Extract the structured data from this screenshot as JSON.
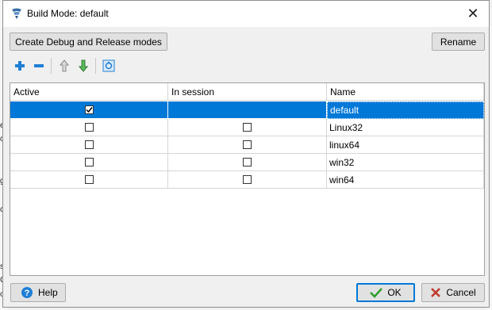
{
  "window": {
    "title": "Build Mode: default"
  },
  "background_left_fragments": [
    "e",
    "o",
    "g",
    "c",
    "s",
    "C",
    "o"
  ],
  "toolbar": {
    "create_modes_label": "Create Debug and Release modes",
    "rename_label": "Rename",
    "icons": [
      "add-icon",
      "remove-icon",
      "move-up-icon",
      "move-down-icon",
      "detect-icon"
    ]
  },
  "table": {
    "headers": [
      "Active",
      "In session",
      "Name"
    ],
    "rows": [
      {
        "name": "default",
        "active": true,
        "in_session": null,
        "selected": true
      },
      {
        "name": "Linux32",
        "active": false,
        "in_session": false,
        "selected": false
      },
      {
        "name": "linux64",
        "active": false,
        "in_session": false,
        "selected": false
      },
      {
        "name": "win32",
        "active": false,
        "in_session": false,
        "selected": false
      },
      {
        "name": "win64",
        "active": false,
        "in_session": false,
        "selected": false
      }
    ]
  },
  "footer": {
    "help_label": "Help",
    "ok_label": "OK",
    "cancel_label": "Cancel"
  },
  "colors": {
    "selection": "#0078d7",
    "add": "#1e7fd6",
    "ok_check": "#2e9e2e",
    "cancel_x": "#c0392b"
  }
}
